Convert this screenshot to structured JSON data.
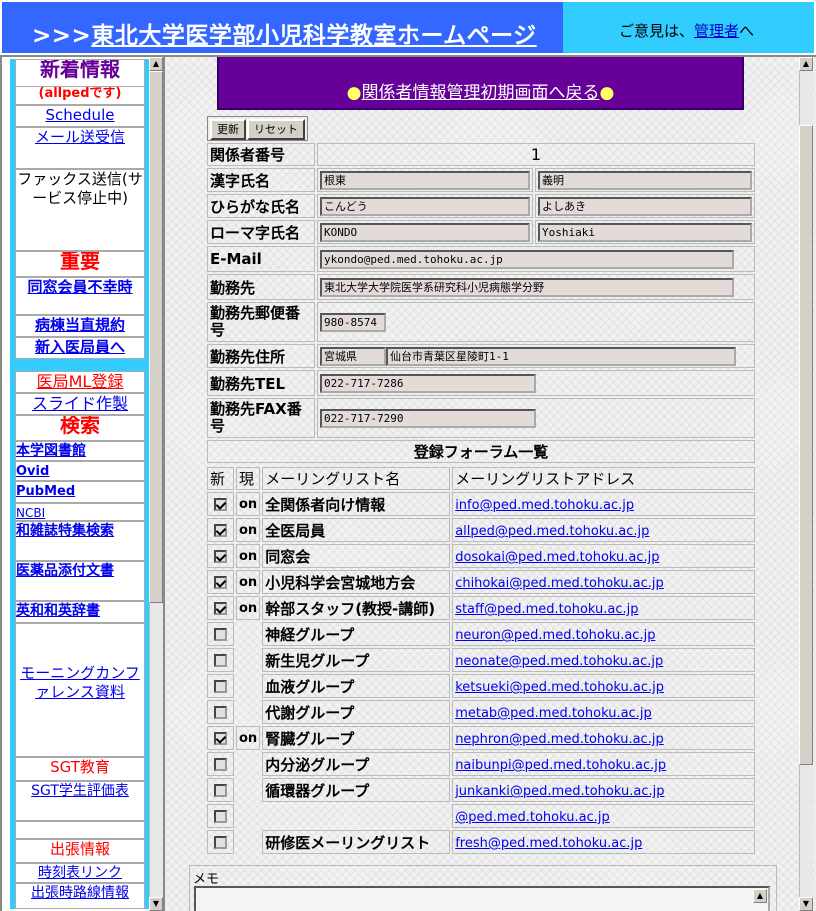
{
  "header": {
    "title": ">>>東北大学医学部小児科学教室ホームページ",
    "title_prefix": ">>>",
    "title_link": "東北大学医学部小児科学教室ホームページ",
    "contact_text": "ご意見は、",
    "contact_link": "管理者",
    "contact_suffix": "へ"
  },
  "sidebar": {
    "items": [
      {
        "label": "新着情報",
        "style": "big-purple"
      },
      {
        "label": "(allpedです)",
        "style": "red-small"
      },
      {
        "label": "Schedule",
        "style": "link"
      },
      {
        "label": "メール送受信",
        "style": "link"
      },
      {
        "label": "ファックス送信(サービス停止中)",
        "style": "plain"
      },
      {
        "label": "重要",
        "style": "big-red"
      },
      {
        "label": "同窓会員不幸時",
        "style": "link"
      },
      {
        "label": "病棟当直規約",
        "style": "link"
      },
      {
        "label": "新入医局員へ",
        "style": "link"
      },
      {
        "label": "医局ML登録",
        "style": "link-red"
      },
      {
        "label": "スライド作製",
        "style": "link"
      },
      {
        "label": "検索",
        "style": "big-red"
      },
      {
        "label": "本学図書館",
        "style": "link-bold"
      },
      {
        "label": "Ovid",
        "style": "link-bold"
      },
      {
        "label": "PubMed",
        "style": "link-bold"
      },
      {
        "label": "NCBI",
        "style": "link"
      },
      {
        "label": "和雑誌特集検索",
        "style": "link-bold"
      },
      {
        "label": "医薬品添付文書",
        "style": "link-bold"
      },
      {
        "label": "英和和英辞書",
        "style": "link-bold"
      },
      {
        "label": "モーニングカンファレンス資料",
        "style": "link"
      },
      {
        "label": "SGT教育",
        "style": "red"
      },
      {
        "label": "SGT学生評価表",
        "style": "link"
      },
      {
        "label": "出張情報",
        "style": "red"
      },
      {
        "label": "時刻表リンク",
        "style": "link"
      },
      {
        "label": "出張時路線情報",
        "style": "link"
      }
    ]
  },
  "main": {
    "back_link": "関係者情報管理初期画面へ戻る",
    "buttons": {
      "update": "更新",
      "reset": "リセット"
    },
    "fields": {
      "member_no_label": "関係者番号",
      "member_no": "1",
      "kanji_label": "漢字氏名",
      "kanji_family": "根東",
      "kanji_given": "義明",
      "hira_label": "ひらがな氏名",
      "hira_family": "こんどう",
      "hira_given": "よしあき",
      "roma_label": "ローマ字氏名",
      "roma_family": "KONDO",
      "roma_given": "Yoshiaki",
      "email_label": "E-Mail",
      "email": "ykondo@ped.med.tohoku.ac.jp",
      "work_label": "勤務先",
      "work": "東北大学大学院医学系研究科小児病態学分野",
      "zip_label": "勤務先郵便番号",
      "zip": "980-8574",
      "addr_label": "勤務先住所",
      "pref": "宮城県",
      "addr": "仙台市青葉区星陵町1-1",
      "tel_label": "勤務先TEL",
      "tel": "022-717-7286",
      "fax_label": "勤務先FAX番号",
      "fax": "022-717-7290"
    },
    "forum_title": "登録フォーラム一覧",
    "forum_headers": [
      "新",
      "現",
      "メーリングリスト名",
      "メーリングリストアドレス"
    ],
    "forums": [
      {
        "checked": true,
        "status": "on",
        "name": "全関係者向け情報",
        "address": "info@ped.med.tohoku.ac.jp"
      },
      {
        "checked": true,
        "status": "on",
        "name": "全医局員",
        "address": "allped@ped.med.tohoku.ac.jp"
      },
      {
        "checked": true,
        "status": "on",
        "name": "同窓会",
        "address": "dosokai@ped.med.tohoku.ac.jp"
      },
      {
        "checked": true,
        "status": "on",
        "name": "小児科学会宮城地方会",
        "address": "chihokai@ped.med.tohoku.ac.jp"
      },
      {
        "checked": true,
        "status": "on",
        "name": "幹部スタッフ(教授-講師)",
        "address": "staff@ped.med.tohoku.ac.jp"
      },
      {
        "checked": false,
        "status": "",
        "name": "神経グループ",
        "address": "neuron@ped.med.tohoku.ac.jp"
      },
      {
        "checked": false,
        "status": "",
        "name": "新生児グループ",
        "address": "neonate@ped.med.tohoku.ac.jp"
      },
      {
        "checked": false,
        "status": "",
        "name": "血液グループ",
        "address": "ketsueki@ped.med.tohoku.ac.jp"
      },
      {
        "checked": false,
        "status": "",
        "name": "代謝グループ",
        "address": "metab@ped.med.tohoku.ac.jp"
      },
      {
        "checked": true,
        "status": "on",
        "name": "腎臓グループ",
        "address": "nephron@ped.med.tohoku.ac.jp"
      },
      {
        "checked": false,
        "status": "",
        "name": "内分泌グループ",
        "address": "naibunpi@ped.med.tohoku.ac.jp"
      },
      {
        "checked": false,
        "status": "",
        "name": "循環器グループ",
        "address": "junkanki@ped.med.tohoku.ac.jp"
      },
      {
        "checked": false,
        "status": "",
        "name": "",
        "address": "@ped.med.tohoku.ac.jp"
      },
      {
        "checked": false,
        "status": "",
        "name": "研修医メーリングリスト",
        "address": "fresh@ped.med.tohoku.ac.jp"
      }
    ],
    "memo_label": "メモ"
  }
}
